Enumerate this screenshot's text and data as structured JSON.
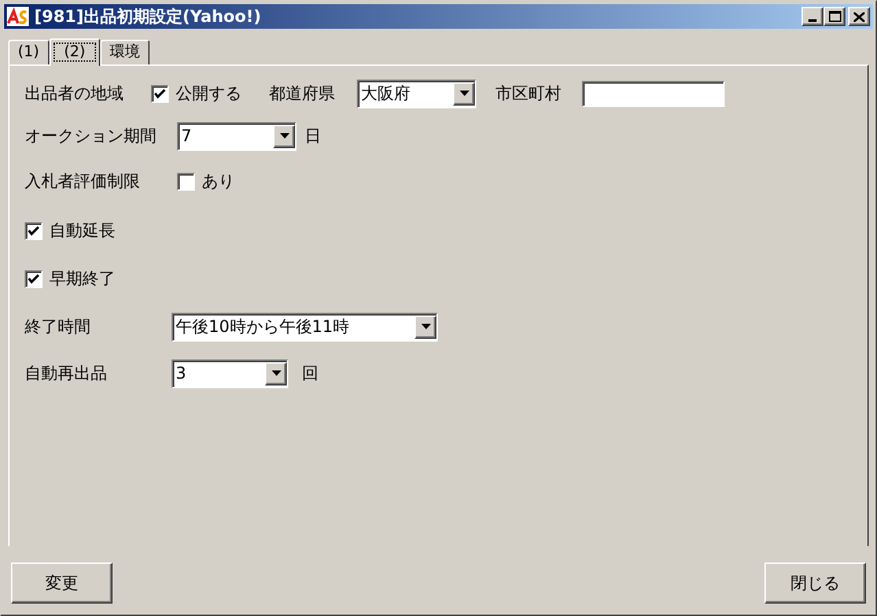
{
  "window": {
    "title": "[981]出品初期設定(Yahoo!)"
  },
  "tabs": [
    {
      "label": "(1)",
      "selected": false
    },
    {
      "label": "(2)",
      "selected": true
    },
    {
      "label": "環境",
      "selected": false
    }
  ],
  "region": {
    "label": "出品者の地域",
    "public_checkbox": {
      "label": "公開する",
      "checked": true
    },
    "prefecture": {
      "label": "都道府県",
      "value": "大阪府"
    },
    "city": {
      "label": "市区町村"
    }
  },
  "auction_period": {
    "label": "オークション期間",
    "value": "7",
    "unit": "日"
  },
  "bidder_limit": {
    "label": "入札者評価制限",
    "checkbox": {
      "label": "あり",
      "checked": false
    }
  },
  "auto_extend": {
    "label": "自動延長",
    "checked": true
  },
  "early_end": {
    "label": "早期終了",
    "checked": true
  },
  "end_time": {
    "label": "終了時間",
    "value": "午後10時から午後11時"
  },
  "auto_relist": {
    "label": "自動再出品",
    "value": "3",
    "unit": "回"
  },
  "buttons": [
    {
      "label": "変更"
    },
    {
      "label": "閉じる"
    }
  ]
}
